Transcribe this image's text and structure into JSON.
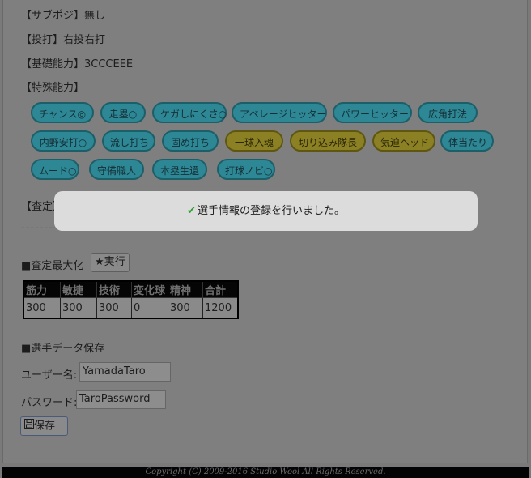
{
  "profile": {
    "sub_position": "【サブポジ】無し",
    "bat_throw": "【投打】右投右打",
    "basic_ability": "【基礎能力】3CCCEEE",
    "special_ability_label": "【特殊能力】"
  },
  "abilities": {
    "row1": [
      {
        "label": "チャンス◎",
        "color": "teal"
      },
      {
        "label": "走塁○",
        "color": "teal"
      },
      {
        "label": "ケガしにくさ○",
        "color": "teal"
      },
      {
        "label": "アベレージヒッター",
        "color": "teal"
      },
      {
        "label": "パワーヒッター",
        "color": "teal"
      },
      {
        "label": "広角打法",
        "color": "teal"
      }
    ],
    "row2": [
      {
        "label": "内野安打○",
        "color": "teal"
      },
      {
        "label": "流し打ち",
        "color": "teal"
      },
      {
        "label": "固め打ち",
        "color": "teal"
      },
      {
        "label": "一球入魂",
        "color": "yellow"
      },
      {
        "label": "切り込み隊長",
        "color": "yellow"
      },
      {
        "label": "気迫ヘッド",
        "color": "yellow"
      },
      {
        "label": "体当たり",
        "color": "teal"
      }
    ],
    "row3": [
      {
        "label": "ムード○",
        "color": "teal"
      },
      {
        "label": "守備職人",
        "color": "teal"
      },
      {
        "label": "本塁生還",
        "color": "teal"
      },
      {
        "label": "打球ノビ○",
        "color": "teal"
      }
    ]
  },
  "assessment": {
    "label": "【査定】1008",
    "divider": "--------------------"
  },
  "maximize": {
    "label": "■査定最大化",
    "button": "★実行"
  },
  "stats_table": {
    "headers": [
      "筋力",
      "敏捷",
      "技術",
      "変化球",
      "精神",
      "合計"
    ],
    "values": [
      "300",
      "300",
      "300",
      "0",
      "300",
      "1200"
    ]
  },
  "save_section": {
    "heading": "■選手データ保存",
    "username_label": "ユーザー名:",
    "username_value": "YamadaTaro",
    "password_label": "パスワード:",
    "password_value": "TaroPassword",
    "save_button": "保存"
  },
  "toast": {
    "message": "選手情報の登録を行いました。"
  },
  "footer": {
    "copyright": "Copyright (C) 2009-2016 Studio Wool All Rights Reserved."
  },
  "colors": {
    "teal_pill": "#2d8794",
    "yellow_pill": "#8c8024",
    "toast_bg": "#dcdcdc",
    "check": "#2aa12f"
  }
}
